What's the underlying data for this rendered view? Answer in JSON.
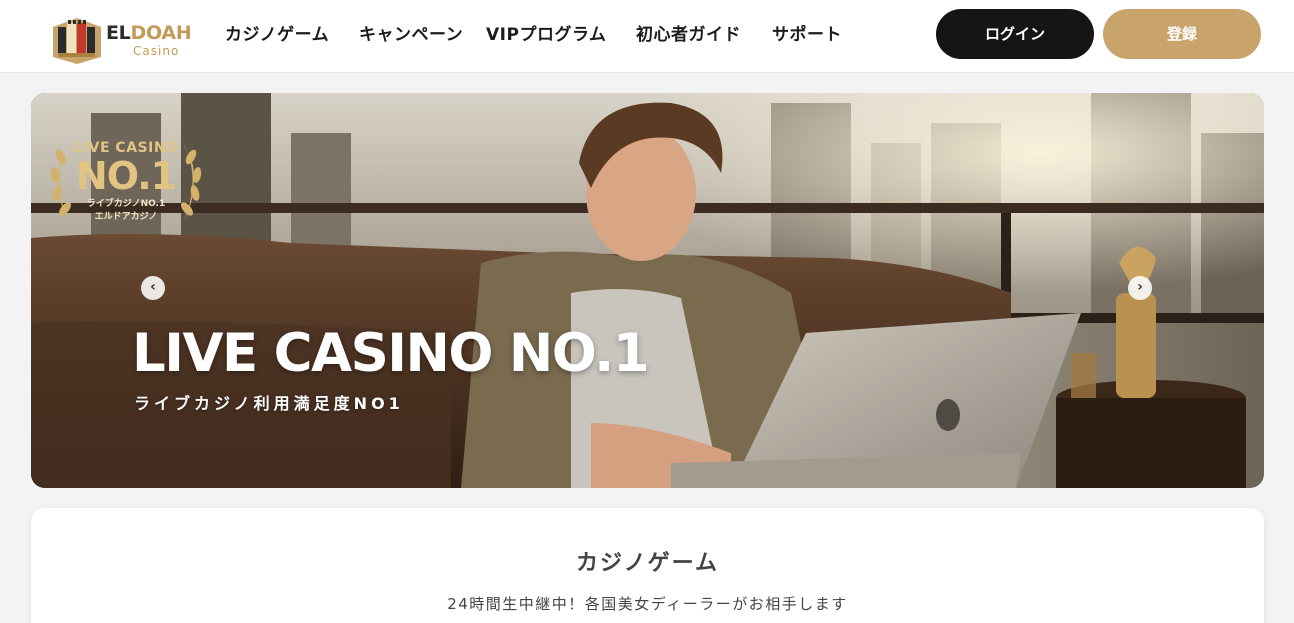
{
  "brand": {
    "name_dark": "EL",
    "name_gold": "DOAH",
    "sub": "Casino"
  },
  "nav": {
    "items": [
      {
        "label": "カジノゲーム"
      },
      {
        "label": "キャンペーン"
      },
      {
        "label": "VIPプログラム"
      },
      {
        "label": "初心者ガイド"
      },
      {
        "label": "サポート"
      }
    ]
  },
  "auth": {
    "login_label": "ログイン",
    "register_label": "登録"
  },
  "hero": {
    "badge": {
      "top": "LIVE CASINO",
      "number": "NO.1",
      "line1": "ライブカジノNO.1",
      "line2": "エルドアカジノ"
    },
    "title": "LIVE CASINO NO.1",
    "subtitle": "ライブカジノ利用満足度NO1",
    "prev_icon": "chevron-left-icon",
    "next_icon": "chevron-right-icon"
  },
  "games_section": {
    "title": "カジノゲーム",
    "subtitle": "24時間生中継中！各国美女ディーラーがお相手します"
  },
  "colors": {
    "accent_gold": "#c9a46a",
    "dark_button": "#151515",
    "brand_text": "#2b2b2b"
  }
}
